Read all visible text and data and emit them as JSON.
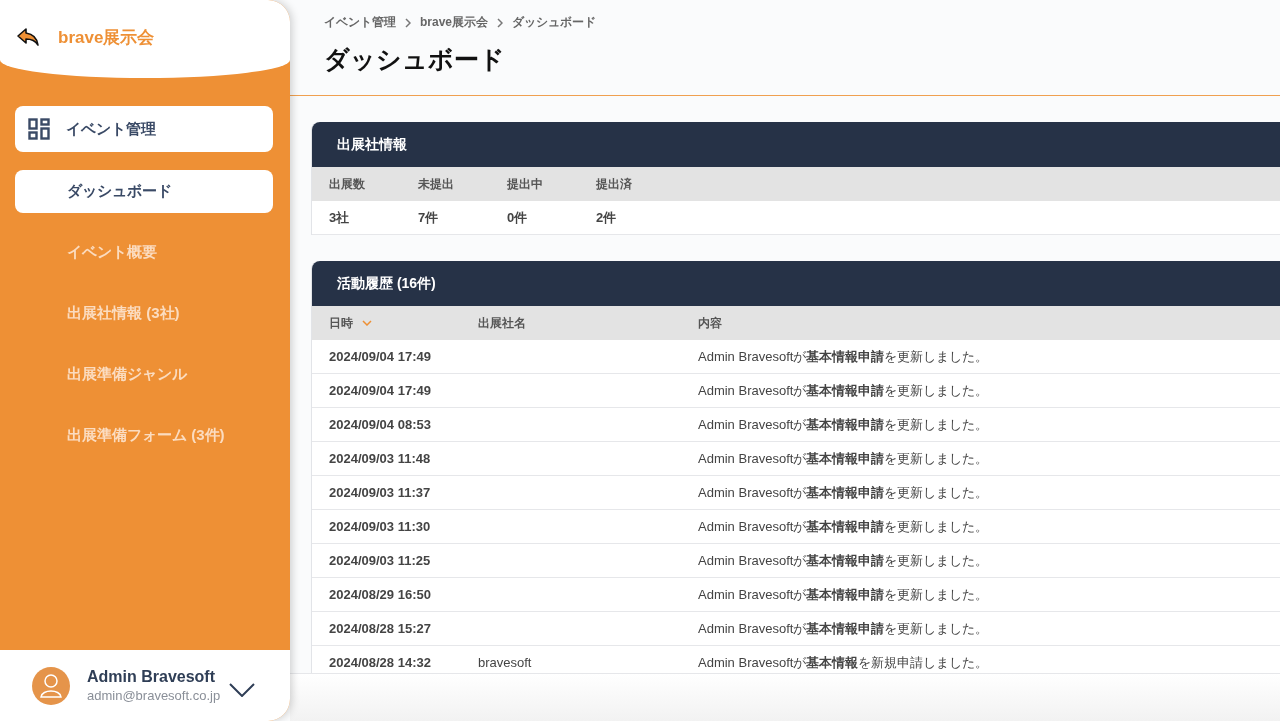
{
  "sidebar": {
    "event_name": "brave展示会",
    "group": {
      "label": "イベント管理"
    },
    "items": [
      {
        "label": "ダッシュボード",
        "selected": true
      },
      {
        "label": "イベント概要",
        "selected": false
      },
      {
        "label": "出展社情報 (3社)",
        "selected": false
      },
      {
        "label": "出展準備ジャンル",
        "selected": false
      },
      {
        "label": "出展準備フォーム (3件)",
        "selected": false
      }
    ],
    "user": {
      "name": "Admin Bravesoft",
      "email": "admin@bravesoft.co.jp"
    }
  },
  "breadcrumb": [
    "イベント管理",
    "brave展示会",
    "ダッシュボード"
  ],
  "page_title": "ダッシュボード",
  "exhibitor_card": {
    "title": "出展社情報",
    "columns": [
      "出展数",
      "未提出",
      "提出中",
      "提出済"
    ],
    "values": [
      "3社",
      "7件",
      "0件",
      "2件"
    ]
  },
  "history_card": {
    "title": "活動履歴 (16件)",
    "columns": [
      {
        "label": "日時",
        "sorted": true
      },
      {
        "label": "出展社名",
        "sorted": false
      },
      {
        "label": "内容",
        "sorted": false
      }
    ],
    "rows": [
      {
        "datetime": "2024/09/04 17:49",
        "exhibitor": "",
        "content": "Admin Bravesoftが**基本情報申請**を更新しました。"
      },
      {
        "datetime": "2024/09/04 17:49",
        "exhibitor": "",
        "content": "Admin Bravesoftが**基本情報申請**を更新しました。"
      },
      {
        "datetime": "2024/09/04 08:53",
        "exhibitor": "",
        "content": "Admin Bravesoftが**基本情報申請**を更新しました。"
      },
      {
        "datetime": "2024/09/03 11:48",
        "exhibitor": "",
        "content": "Admin Bravesoftが**基本情報申請**を更新しました。"
      },
      {
        "datetime": "2024/09/03 11:37",
        "exhibitor": "",
        "content": "Admin Bravesoftが**基本情報申請**を更新しました。"
      },
      {
        "datetime": "2024/09/03 11:30",
        "exhibitor": "",
        "content": "Admin Bravesoftが**基本情報申請**を更新しました。"
      },
      {
        "datetime": "2024/09/03 11:25",
        "exhibitor": "",
        "content": "Admin Bravesoftが**基本情報申請**を更新しました。"
      },
      {
        "datetime": "2024/08/29 16:50",
        "exhibitor": "",
        "content": "Admin Bravesoftが**基本情報申請**を更新しました。"
      },
      {
        "datetime": "2024/08/28 15:27",
        "exhibitor": "",
        "content": "Admin Bravesoftが**基本情報申請**を更新しました。"
      },
      {
        "datetime": "2024/08/28 14:32",
        "exhibitor": "bravesoft",
        "content": "Admin Bravesoftが**基本情報**を新規申請しました。"
      }
    ]
  }
}
